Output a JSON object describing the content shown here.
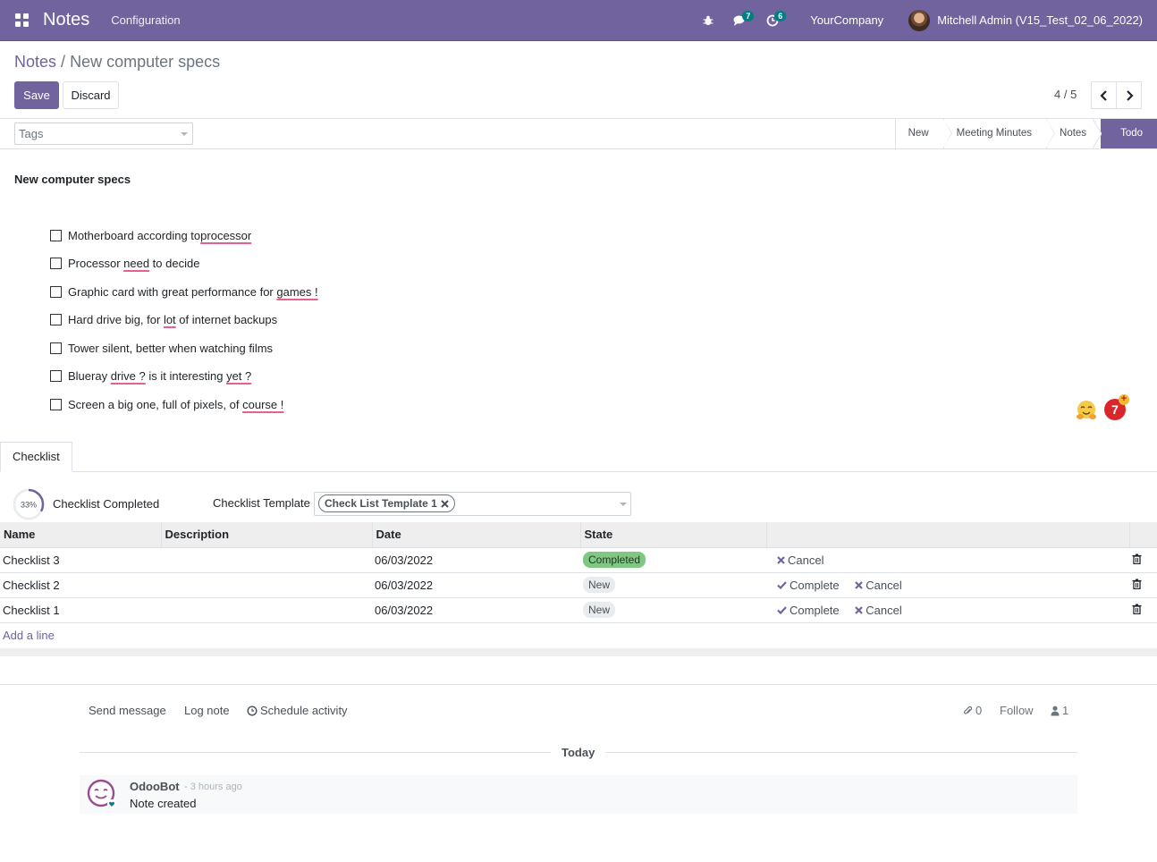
{
  "navbar": {
    "app_name": "Notes",
    "menu_configuration": "Configuration",
    "messages_count": "7",
    "activities_count": "6",
    "company": "YourCompany",
    "user": "Mitchell Admin (V15_Test_02_06_2022)",
    "icons": [
      "apps-grid-icon",
      "bug-icon",
      "chat-icon",
      "clock-icon"
    ]
  },
  "breadcrumb": {
    "parent": "Notes",
    "separator": "/",
    "current": "New computer specs"
  },
  "buttons": {
    "save": "Save",
    "discard": "Discard"
  },
  "pager": {
    "value": "4 / 5"
  },
  "tags": {
    "placeholder": "Tags"
  },
  "stages": [
    "New",
    "Meeting Minutes",
    "Notes",
    "Todo"
  ],
  "active_stage": "Todo",
  "note": {
    "title": "New computer specs",
    "items": [
      {
        "pre": "Motherboard according to ",
        "err": "processor",
        "post": ""
      },
      {
        "pre": "Processor ",
        "err": "need",
        "post": " to decide"
      },
      {
        "pre": "Graphic card with great performance for ",
        "err": "games !",
        "post": ""
      },
      {
        "pre": "Hard drive big, for ",
        "err": "lot",
        "post": " of internet backups"
      },
      {
        "pre": "Tower silent, better when watching films",
        "err": "",
        "post": ""
      },
      {
        "pre": "Blueray ",
        "err": "drive ?",
        "post": " is it interesting ",
        "err2": "yet ?"
      },
      {
        "pre": "Screen a big one, full of pixels, of ",
        "err": "course !",
        "post": ""
      }
    ],
    "grammar_count": "7"
  },
  "notebook": {
    "tab": "Checklist",
    "progress_label": "33%",
    "progress_value": 0.33,
    "completed_label": "Checklist Completed",
    "template_label": "Checklist Template",
    "template_tag": "Check List Template 1"
  },
  "table": {
    "columns": [
      "Name",
      "Description",
      "Date",
      "State"
    ],
    "rows": [
      {
        "name": "Checklist 3",
        "description": "",
        "date": "06/03/2022",
        "state": "Completed",
        "actions": [
          "Cancel"
        ]
      },
      {
        "name": "Checklist 2",
        "description": "",
        "date": "06/03/2022",
        "state": "New",
        "actions": [
          "Complete",
          "Cancel"
        ]
      },
      {
        "name": "Checklist 1",
        "description": "",
        "date": "06/03/2022",
        "state": "New",
        "actions": [
          "Complete",
          "Cancel"
        ]
      }
    ],
    "add_line": "Add a line"
  },
  "chatter": {
    "send_message": "Send message",
    "log_note": "Log note",
    "schedule_activity": "Schedule activity",
    "attachments": "0",
    "follow": "Follow",
    "followers": "1",
    "today": "Today",
    "message": {
      "author": "OdooBot",
      "date": "- 3 hours ago",
      "body": "Note created"
    }
  },
  "colors": {
    "brand": "#71639e",
    "badge": "#017e84",
    "completed": "#81c784"
  }
}
